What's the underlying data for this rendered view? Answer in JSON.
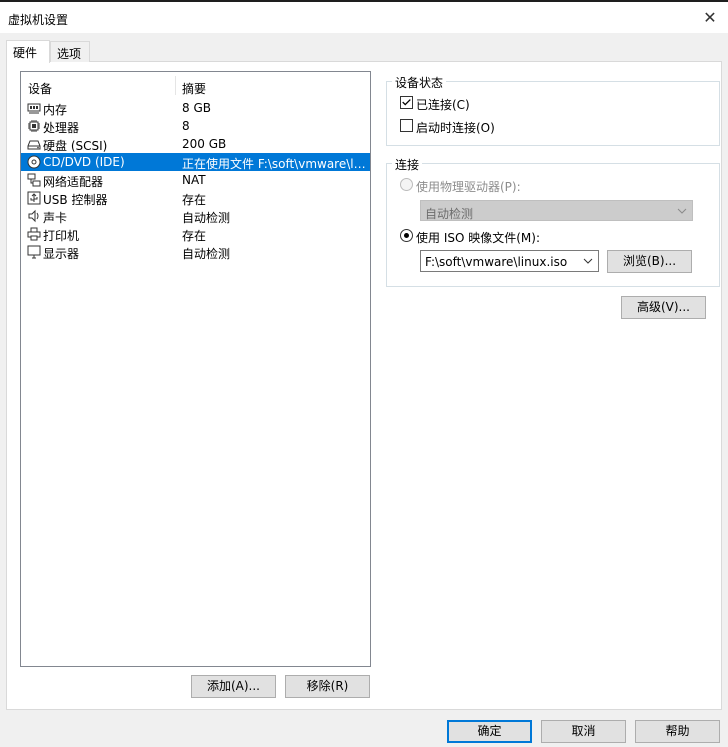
{
  "window": {
    "title": "虚拟机设置"
  },
  "tabs": [
    {
      "label": "硬件",
      "active": true
    },
    {
      "label": "选项",
      "active": false
    }
  ],
  "device_list": {
    "columns": [
      "设备",
      "摘要"
    ],
    "rows": [
      {
        "name": "内存",
        "summary": "8 GB",
        "icon": "memory-icon"
      },
      {
        "name": "处理器",
        "summary": "8",
        "icon": "cpu-icon"
      },
      {
        "name": "硬盘 (SCSI)",
        "summary": "200 GB",
        "icon": "harddisk-icon"
      },
      {
        "name": "CD/DVD (IDE)",
        "summary": "正在使用文件 F:\\soft\\vmware\\li...",
        "icon": "cd-dvd-icon",
        "selected": true
      },
      {
        "name": "网络适配器",
        "summary": "NAT",
        "icon": "network-adapter-icon"
      },
      {
        "name": "USB 控制器",
        "summary": "存在",
        "icon": "usb-icon"
      },
      {
        "name": "声卡",
        "summary": "自动检测",
        "icon": "speaker-icon"
      },
      {
        "name": "打印机",
        "summary": "存在",
        "icon": "printer-icon"
      },
      {
        "name": "显示器",
        "summary": "自动检测",
        "icon": "monitor-icon"
      }
    ]
  },
  "list_buttons": {
    "add": "添加(A)...",
    "remove": "移除(R)"
  },
  "device_status": {
    "title": "设备状态",
    "connected": {
      "label": "已连接(C)",
      "checked": true
    },
    "connect_at_power_on": {
      "label": "启动时连接(O)",
      "checked": false
    }
  },
  "connection": {
    "title": "连接",
    "physical_drive": {
      "label": "使用物理驱动器(P):",
      "selected": false,
      "disabled": true,
      "value": "自动检测"
    },
    "iso_file": {
      "label": "使用 ISO 映像文件(M):",
      "selected": true,
      "value": "F:\\soft\\vmware\\linux.iso"
    },
    "browse": "浏览(B)..."
  },
  "advanced": "高级(V)...",
  "footer": {
    "ok": "确定",
    "cancel": "取消",
    "help": "帮助"
  }
}
